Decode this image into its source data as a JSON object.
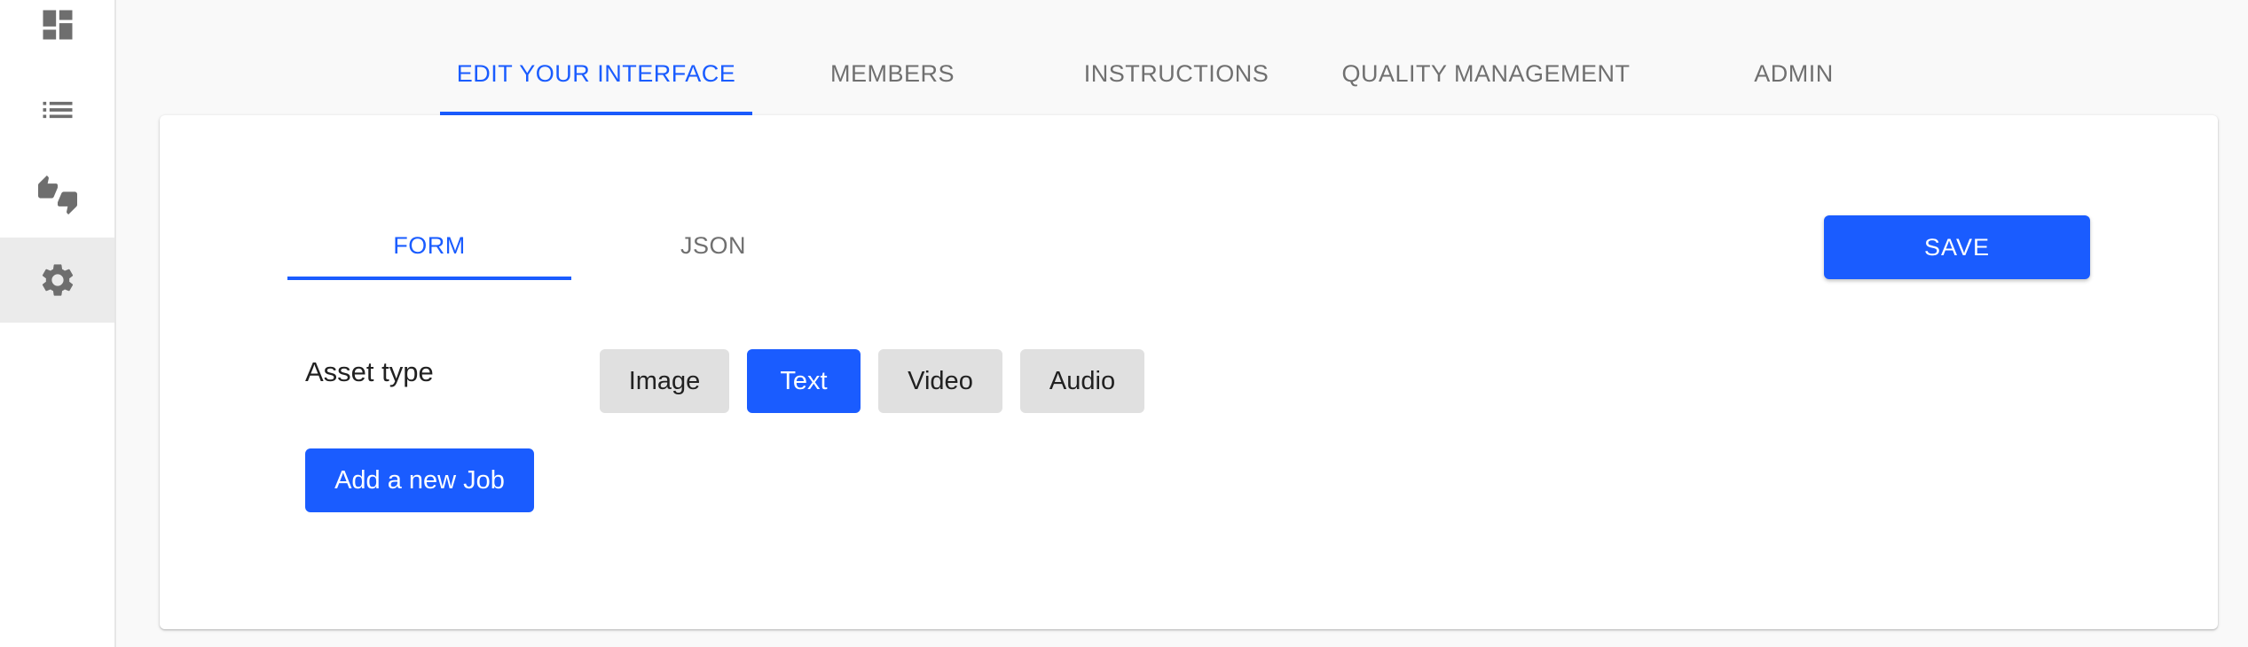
{
  "sidebar": {
    "items": [
      {
        "name": "dashboard-icon"
      },
      {
        "name": "list-icon"
      },
      {
        "name": "thumbs-up-down-icon"
      },
      {
        "name": "gear-icon",
        "active": true
      }
    ]
  },
  "top_tabs": [
    {
      "label": "EDIT YOUR INTERFACE",
      "active": true
    },
    {
      "label": "MEMBERS"
    },
    {
      "label": "INSTRUCTIONS"
    },
    {
      "label": "QUALITY MANAGEMENT"
    },
    {
      "label": "ADMIN"
    }
  ],
  "editor": {
    "sub_tabs": [
      {
        "label": "FORM",
        "active": true
      },
      {
        "label": "JSON"
      }
    ],
    "save_label": "SAVE",
    "asset_type_label": "Asset type",
    "asset_types": [
      {
        "label": "Image"
      },
      {
        "label": "Text",
        "selected": true
      },
      {
        "label": "Video"
      },
      {
        "label": "Audio"
      }
    ],
    "add_job_label": "Add a new Job"
  },
  "colors": {
    "accent": "#1a5cff",
    "inactive_text": "#707070",
    "button_grey": "#e0e0e0",
    "sidebar_active_bg": "#ebebeb"
  }
}
